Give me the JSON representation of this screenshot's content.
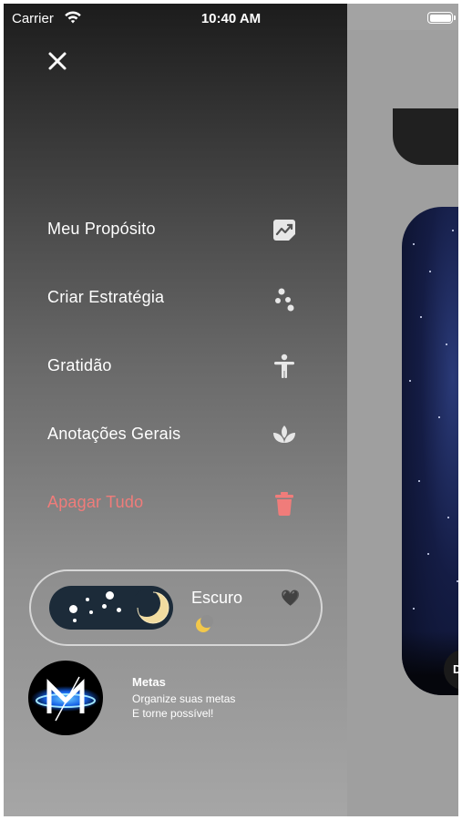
{
  "status_bar": {
    "carrier": "Carrier",
    "time": "10:40 AM"
  },
  "menu": {
    "items": [
      {
        "label": "Meu Propósito",
        "icon": "purpose-chart-icon"
      },
      {
        "label": "Criar Estratégia",
        "icon": "strategy-dots-icon"
      },
      {
        "label": "Gratidão",
        "icon": "person-icon"
      },
      {
        "label": "Anotações Gerais",
        "icon": "lotus-icon"
      },
      {
        "label": "Apagar Tudo",
        "icon": "trash-icon"
      }
    ],
    "danger_color": "#f07c7a"
  },
  "theme": {
    "label": "Escuro",
    "heart": "🖤",
    "mode": "dark"
  },
  "app": {
    "name": "Metas",
    "tagline_line1": "Organize suas metas",
    "tagline_line2": "E torne possível!"
  },
  "preview": {
    "badge_text": "D"
  }
}
